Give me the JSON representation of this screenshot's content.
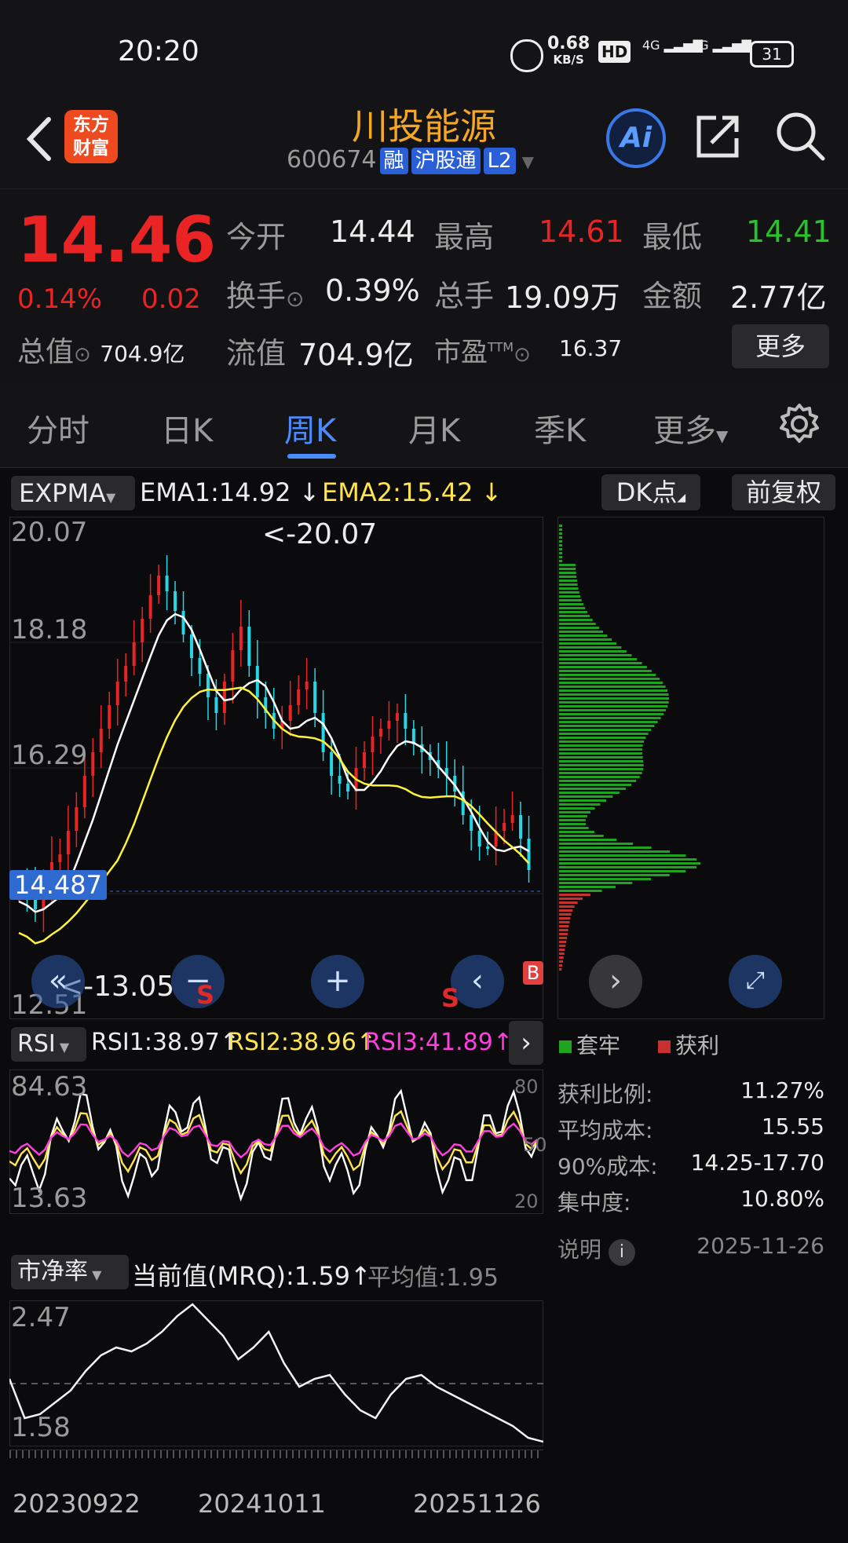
{
  "status_bar": {
    "time": "20:20",
    "net_speed": "0.68",
    "net_unit": "KB/S",
    "hd": "HD",
    "signal1": "4G",
    "signal2": "4G",
    "battery": "31"
  },
  "header": {
    "logo_line1": "东方",
    "logo_line2": "财富",
    "stock_name": "川投能源",
    "stock_code": "600674",
    "tags": [
      "融",
      "沪股通",
      "L2"
    ],
    "ai_label": "Ai"
  },
  "quote": {
    "price": "14.46",
    "change_pct": "0.14%",
    "change_abs": "0.02",
    "total_value_label": "总值",
    "total_value": "704.9亿",
    "open_label": "今开",
    "open": "14.44",
    "high_label": "最高",
    "high": "14.61",
    "low_label": "最低",
    "low": "14.41",
    "turnover_label": "换手",
    "turnover": "0.39%",
    "volume_label": "总手",
    "volume": "19.09万",
    "amount_label": "金额",
    "amount": "2.77亿",
    "float_label": "流值",
    "float_value": "704.9亿",
    "pe_label": "市盈",
    "pe_sup": "TTM",
    "pe": "16.37",
    "more_button": "更多"
  },
  "tabs": {
    "items": [
      "分时",
      "日K",
      "周K",
      "月K",
      "季K",
      "更多"
    ],
    "active": "周K"
  },
  "indicator_bar": {
    "name": "EXPMA",
    "ema1": "EMA1:14.92",
    "ema2": "EMA2:15.42",
    "dk_button": "DK点",
    "fq_button": "前复权"
  },
  "main_chart": {
    "y_labels": [
      "20.07",
      "18.18",
      "16.29",
      "14.487",
      "12.51"
    ],
    "max_annotation": "<-20.07",
    "min_annotation": "<-13.05",
    "current_price_tag": "14.487",
    "sell_marks": [
      "S",
      "S"
    ],
    "buy_mark": "B"
  },
  "chip_distribution": {
    "legend_trapped": "套牢",
    "legend_profit": "获利",
    "profit_ratio_label": "获利比例:",
    "profit_ratio": "11.27%",
    "avg_cost_label": "平均成本:",
    "avg_cost": "15.55",
    "cost90_label": "90%成本:",
    "cost90": "14.25-17.70",
    "concentration_label": "集中度:",
    "concentration": "10.80%",
    "note_label": "说明",
    "date": "2025-11-26"
  },
  "rsi": {
    "name": "RSI",
    "rsi1": "RSI1:38.97",
    "rsi2": "RSI2:38.96",
    "rsi3": "RSI3:41.89",
    "y_labels": [
      "84.63",
      "13.63"
    ],
    "right_labels": [
      "80",
      "50",
      "20"
    ]
  },
  "pb": {
    "name": "市净率",
    "current": "当前值(MRQ):1.59",
    "avg": "平均值:1.95",
    "y_labels": [
      "2.47",
      "1.58"
    ]
  },
  "x_axis": {
    "dates": [
      "20230922",
      "20241011",
      "20251126"
    ]
  },
  "colors": {
    "up": "#ea2424",
    "down": "#27d6e6",
    "ema1": "#ffffff",
    "ema2": "#fff23a",
    "rsi1": "#ffffff",
    "rsi2": "#ffe44d",
    "rsi3": "#ff3fe0",
    "trapped": "#1fa41f",
    "profit": "#c93030",
    "accent": "#4a8cff",
    "name": "#f5a623"
  }
}
